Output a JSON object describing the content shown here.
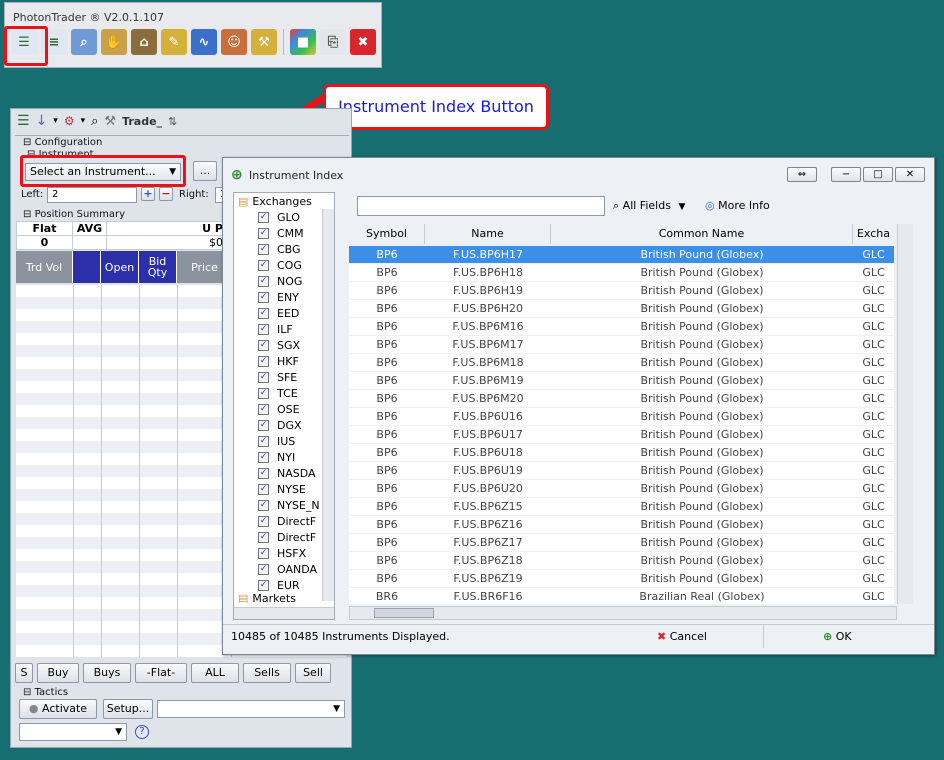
{
  "app": {
    "title": "PhotonTrader ® V2.0.1.107"
  },
  "callout": {
    "text": "Instrument Index Button"
  },
  "trader": {
    "tab_label": "Trade_",
    "configuration_label": "Configuration",
    "instrument_label": "Instrument",
    "instrument_select": "Select an Instrument...",
    "index_button": "...",
    "left_label": "Left:",
    "left_value": "2",
    "right_label": "Right:",
    "right_value": "3",
    "position_summary_label": "Position Summary",
    "ps_headers": [
      "Flat",
      "AVG",
      "U P"
    ],
    "ps_values": [
      "0",
      "",
      "$0"
    ],
    "ladder_headers": [
      "Trd Vol",
      "",
      "Open",
      "Bid Qty",
      "Price"
    ],
    "order_buttons": [
      "S",
      "Buy",
      "Buys",
      "-Flat-",
      "ALL",
      "Sells",
      "Sell"
    ],
    "tactics_label": "Tactics",
    "activate_label": "Activate",
    "setup_label": "Setup...",
    "help_label": "?"
  },
  "dialog": {
    "title": "Instrument Index",
    "search_value": "",
    "fields_filter": "All Fields",
    "more_info": "More Info",
    "exchanges_label": "Exchanges",
    "markets_label": "Markets",
    "exchanges": [
      "GLO",
      "CMM",
      "CBG",
      "COG",
      "NOG",
      "ENY",
      "EED",
      "ILF",
      "SGX",
      "HKF",
      "SFE",
      "TCE",
      "OSE",
      "DGX",
      "IUS",
      "NYI",
      "NASDA",
      "NYSE",
      "NYSE_N",
      "DirectF",
      "DirectF",
      "HSFX",
      "OANDA",
      "EUR"
    ],
    "columns": [
      "Symbol",
      "Name",
      "Common Name",
      "Excha"
    ],
    "rows": [
      [
        "BP6",
        "F.US.BP6H17",
        "British Pound (Globex)",
        "GLC"
      ],
      [
        "BP6",
        "F.US.BP6H18",
        "British Pound (Globex)",
        "GLC"
      ],
      [
        "BP6",
        "F.US.BP6H19",
        "British Pound (Globex)",
        "GLC"
      ],
      [
        "BP6",
        "F.US.BP6H20",
        "British Pound (Globex)",
        "GLC"
      ],
      [
        "BP6",
        "F.US.BP6M16",
        "British Pound (Globex)",
        "GLC"
      ],
      [
        "BP6",
        "F.US.BP6M17",
        "British Pound (Globex)",
        "GLC"
      ],
      [
        "BP6",
        "F.US.BP6M18",
        "British Pound (Globex)",
        "GLC"
      ],
      [
        "BP6",
        "F.US.BP6M19",
        "British Pound (Globex)",
        "GLC"
      ],
      [
        "BP6",
        "F.US.BP6M20",
        "British Pound (Globex)",
        "GLC"
      ],
      [
        "BP6",
        "F.US.BP6U16",
        "British Pound (Globex)",
        "GLC"
      ],
      [
        "BP6",
        "F.US.BP6U17",
        "British Pound (Globex)",
        "GLC"
      ],
      [
        "BP6",
        "F.US.BP6U18",
        "British Pound (Globex)",
        "GLC"
      ],
      [
        "BP6",
        "F.US.BP6U19",
        "British Pound (Globex)",
        "GLC"
      ],
      [
        "BP6",
        "F.US.BP6U20",
        "British Pound (Globex)",
        "GLC"
      ],
      [
        "BP6",
        "F.US.BP6Z15",
        "British Pound (Globex)",
        "GLC"
      ],
      [
        "BP6",
        "F.US.BP6Z16",
        "British Pound (Globex)",
        "GLC"
      ],
      [
        "BP6",
        "F.US.BP6Z17",
        "British Pound (Globex)",
        "GLC"
      ],
      [
        "BP6",
        "F.US.BP6Z18",
        "British Pound (Globex)",
        "GLC"
      ],
      [
        "BP6",
        "F.US.BP6Z19",
        "British Pound (Globex)",
        "GLC"
      ],
      [
        "BR6",
        "F.US.BR6F16",
        "Brazilian Real (Globex)",
        "GLC"
      ]
    ],
    "status": "10485 of 10485 Instruments Displayed.",
    "cancel_label": "Cancel",
    "ok_label": "OK"
  },
  "colors": {
    "accent_red": "#e8131a",
    "selection": "#3c8fe6",
    "callout_text": "#1a1ad8",
    "desktop": "#176e70"
  }
}
